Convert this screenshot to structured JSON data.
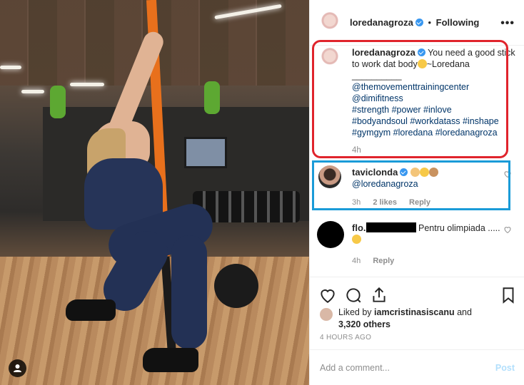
{
  "post": {
    "username": "loredanagroza",
    "follow_status": "Following",
    "more_label": "•••",
    "caption": {
      "username": "loredanagroza",
      "text_line1": "You need a good stick to work dat body",
      "text_line1_end": "~Loredana",
      "divider": "__________",
      "mentions": [
        "@themovementtrainingcenter",
        "@dimifitness"
      ],
      "hashtags_line1": "#strength #power #inlove",
      "hashtags_line2": "#bodyandsoul #workdatass #inshape",
      "hashtags_line3": "#gymgym #loredana #loredanagroza",
      "age": "4h"
    },
    "comments": [
      {
        "username": "taviclonda",
        "text": "@loredanagroza",
        "age": "3h",
        "likes": "2 likes",
        "reply": "Reply"
      },
      {
        "username": "flo.",
        "text": "Pentru olimpiada .....",
        "age": "4h",
        "reply": "Reply"
      }
    ],
    "likes": {
      "prefix": "Liked by",
      "liker": "iamcristinasiscanu",
      "and": "and",
      "count": "3,320 others"
    },
    "timestamp": "4 HOURS AGO",
    "add_comment_placeholder": "Add a comment...",
    "post_button": "Post"
  },
  "colors": {
    "verified": "#3897f0",
    "link": "#003569",
    "muted": "#8e8e8e",
    "annotation_red": "#e0242c",
    "annotation_blue": "#1a9bd8"
  },
  "icons": [
    "verified-badge-icon",
    "heart-icon",
    "comment-icon",
    "share-icon",
    "bookmark-icon",
    "user-tag-icon",
    "more-options-icon"
  ]
}
